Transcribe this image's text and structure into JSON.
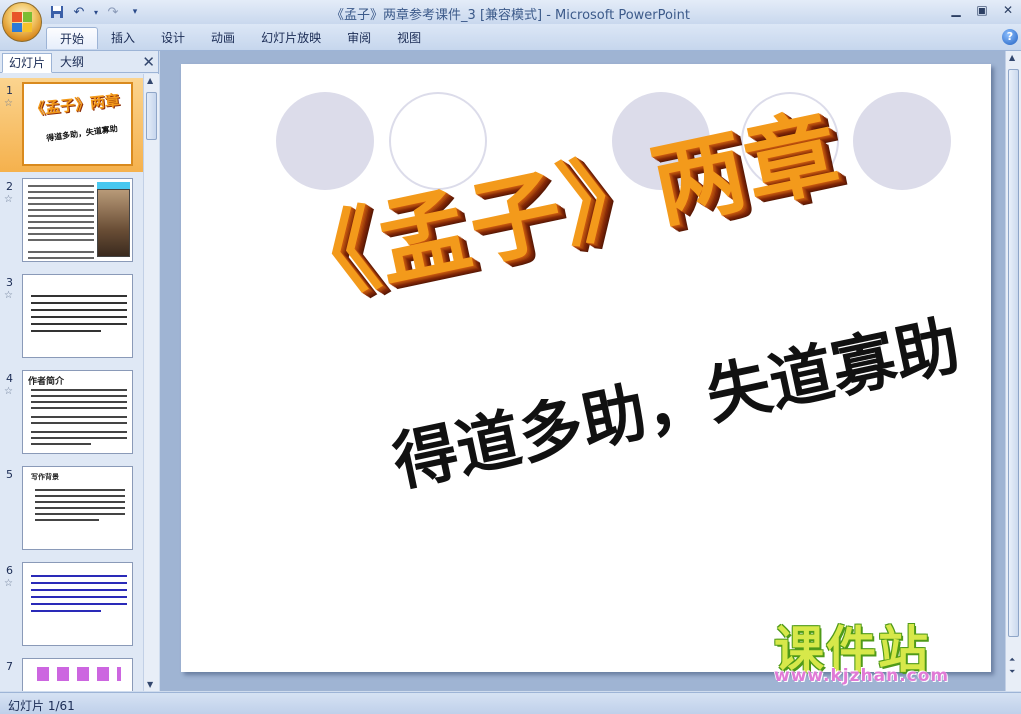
{
  "window": {
    "title": "《孟子》两章参考课件_3 [兼容模式] - Microsoft PowerPoint"
  },
  "ribbon": {
    "tabs": [
      {
        "label": "开始",
        "active": true
      },
      {
        "label": "插入"
      },
      {
        "label": "设计"
      },
      {
        "label": "动画"
      },
      {
        "label": "幻灯片放映"
      },
      {
        "label": "审阅"
      },
      {
        "label": "视图"
      }
    ],
    "help": "?"
  },
  "left_pane": {
    "tab_slides": "幻灯片",
    "tab_outline": "大纲",
    "thumbnails": [
      {
        "num": "1",
        "title": "《孟子》两章",
        "subtitle": "得道多助，失道寡助"
      },
      {
        "num": "2"
      },
      {
        "num": "3"
      },
      {
        "num": "4",
        "title": "作者简介"
      },
      {
        "num": "5",
        "title": "写作背景"
      },
      {
        "num": "6"
      },
      {
        "num": "7"
      }
    ]
  },
  "slide": {
    "title": "《孟子》两章",
    "subtitle": "得道多助，失道寡助"
  },
  "watermark": {
    "brand": "课件站",
    "url": "www.kjzhan.com"
  },
  "status": {
    "slide_indicator": "幻灯片 1/61"
  },
  "colors": {
    "title_orange": "#f39a1b",
    "title_shadow": "#8a2a08",
    "selection": "#f5b14d"
  }
}
